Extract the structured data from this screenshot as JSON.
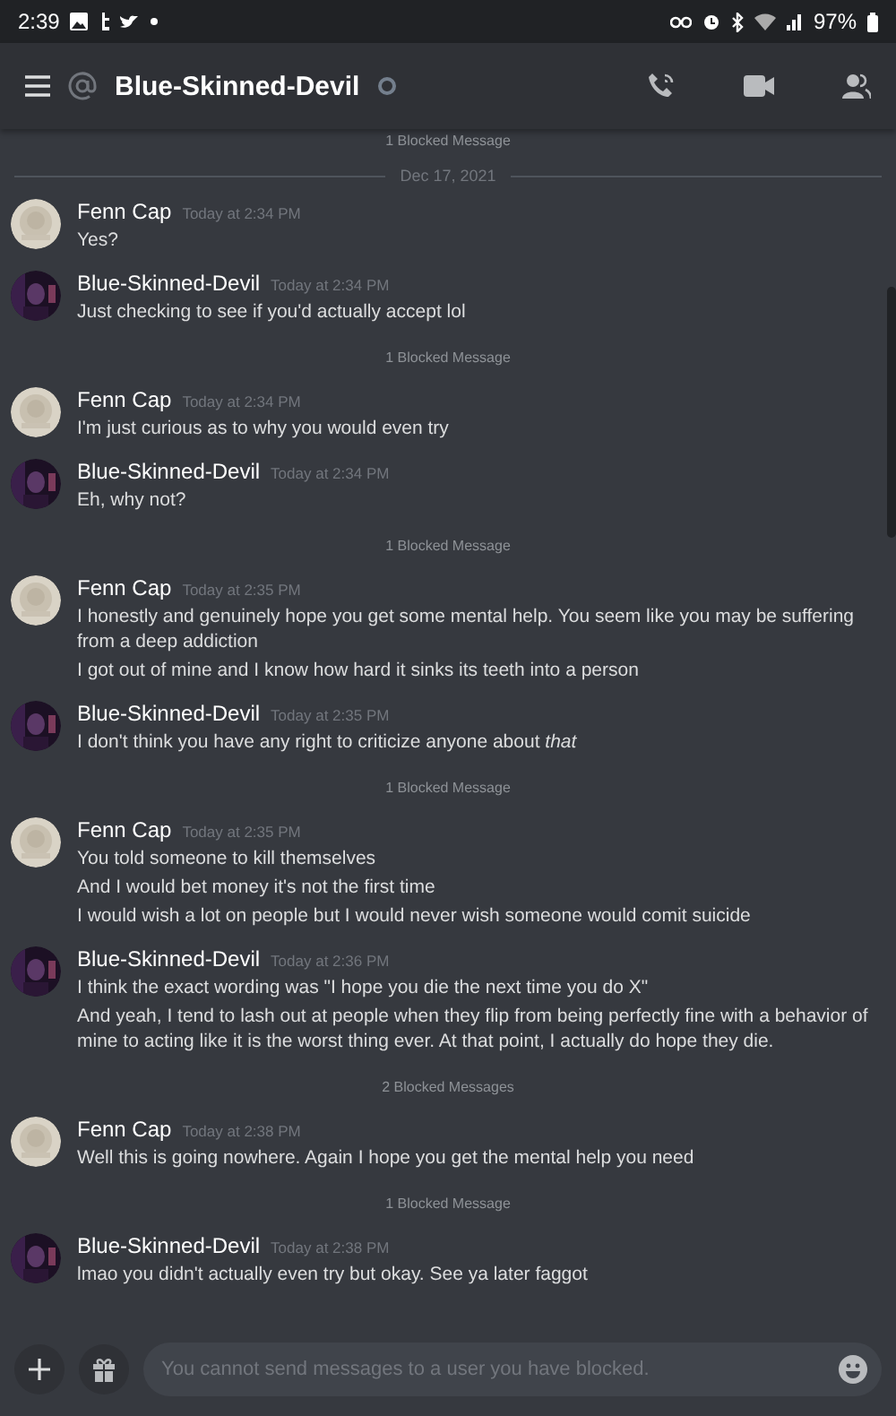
{
  "status_bar": {
    "time": "2:39",
    "battery": "97%"
  },
  "header": {
    "title": "Blue-Skinned-Devil",
    "online": false
  },
  "feed": [
    {
      "kind": "blocked",
      "text": "1 Blocked Message"
    },
    {
      "kind": "date",
      "text": "Dec 17, 2021"
    },
    {
      "kind": "message",
      "author": "Fenn Cap",
      "time": "Today at 2:34 PM",
      "avatar": {
        "kind": "picture"
      },
      "lines": [
        "Yes?"
      ]
    },
    {
      "kind": "message",
      "author": "Blue-Skinned-Devil",
      "time": "Today at 2:34 PM",
      "avatar": {
        "kind": "picture"
      },
      "lines": [
        "Just checking to see if you'd actually accept lol"
      ]
    },
    {
      "kind": "blocked",
      "text": "1 Blocked Message"
    },
    {
      "kind": "message",
      "author": "Fenn Cap",
      "time": "Today at 2:34 PM",
      "avatar": {
        "kind": "picture"
      },
      "lines": [
        "I'm just curious as to why you would even try"
      ]
    },
    {
      "kind": "message",
      "author": "Blue-Skinned-Devil",
      "time": "Today at 2:34 PM",
      "avatar": {
        "kind": "picture"
      },
      "lines": [
        "Eh, why not?"
      ]
    },
    {
      "kind": "blocked",
      "text": "1 Blocked Message"
    },
    {
      "kind": "message",
      "author": "Fenn Cap",
      "time": "Today at 2:35 PM",
      "avatar": {
        "kind": "picture"
      },
      "lines": [
        "I honestly and genuinely hope you get some mental help. You seem like you may be suffering from a deep addiction",
        "I got out of mine and I know how hard it sinks its teeth into a person"
      ]
    },
    {
      "kind": "message",
      "author": "Blue-Skinned-Devil",
      "time": "Today at 2:35 PM",
      "avatar": {
        "kind": "picture"
      },
      "lines": [
        "I don't think you have any right to criticize anyone about *that*"
      ]
    },
    {
      "kind": "blocked",
      "text": "1 Blocked Message"
    },
    {
      "kind": "message",
      "author": "Fenn Cap",
      "time": "Today at 2:35 PM",
      "avatar": {
        "kind": "picture"
      },
      "lines": [
        "You told someone to kill themselves",
        "And I would bet money it's not the first time",
        "I would wish a lot on people but I would never wish someone would comit suicide"
      ]
    },
    {
      "kind": "message",
      "author": "Blue-Skinned-Devil",
      "time": "Today at 2:36 PM",
      "avatar": {
        "kind": "picture"
      },
      "lines": [
        "I think the exact wording was \"I hope you die the next time you do X\"",
        "And yeah, I tend to lash out at people when they flip from being perfectly fine with a behavior of mine to acting like it is the worst thing ever. At that point, I actually do hope they die."
      ]
    },
    {
      "kind": "blocked",
      "text": "2 Blocked Messages"
    },
    {
      "kind": "message",
      "author": "Fenn Cap",
      "time": "Today at 2:38 PM",
      "avatar": {
        "kind": "picture"
      },
      "lines": [
        "Well this is going nowhere. Again I hope you get the mental help you need"
      ]
    },
    {
      "kind": "blocked",
      "text": "1 Blocked Message"
    },
    {
      "kind": "message",
      "author": "Blue-Skinned-Devil",
      "time": "Today at 2:38 PM",
      "avatar": {
        "kind": "picture"
      },
      "lines": [
        "lmao you didn't actually even try but okay. See ya later faggot"
      ]
    }
  ],
  "composer": {
    "placeholder": "You cannot send messages to a user you have blocked."
  }
}
